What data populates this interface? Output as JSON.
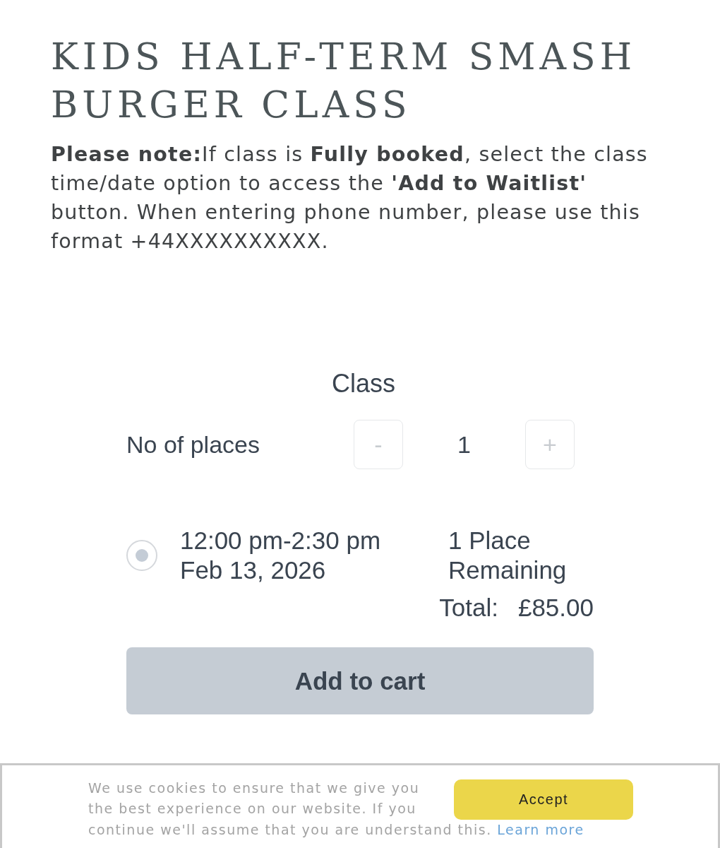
{
  "title": "KIDS HALF-TERM SMASH BURGER CLASS",
  "note": "**Please note:**If class is **Fully booked**, select the class time/date option to access the **'Add to Waitlist'** button. When entering phone number, please use this format +44XXXXXXXXXX.",
  "booking": {
    "heading": "Class",
    "places_label": "No of places",
    "decrement": "-",
    "quantity": "1",
    "increment": "+",
    "slots": [
      {
        "time": "12:00 pm-2:30 pm",
        "date": "Feb 13, 2026",
        "availability": "1 Place Remaining",
        "selected": true
      }
    ],
    "total_label": "Total:",
    "total_value": "£85.00",
    "add_button": "Add to cart"
  },
  "cookie_banner": {
    "text_start": "We use cookies to ensure that we give you the best experience on our website. If you",
    "text_end": "continue we'll assume that you are understand this.",
    "link": "Learn more",
    "accept": "Accept"
  }
}
